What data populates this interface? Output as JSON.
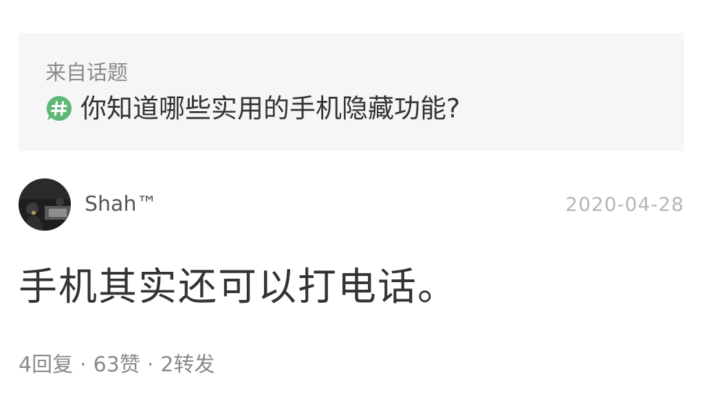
{
  "topic": {
    "from_label": "来自话题",
    "icon": "hashtag-icon",
    "title": "你知道哪些实用的手机隐藏功能?",
    "accent_color": "#5fb878"
  },
  "post": {
    "author": "Shah™",
    "avatar": "user-avatar",
    "date": "2020-04-28",
    "content": "手机其实还可以打电话。"
  },
  "stats": {
    "replies": "4回复",
    "likes": "63赞",
    "reposts": "2转发",
    "separator": "·"
  }
}
